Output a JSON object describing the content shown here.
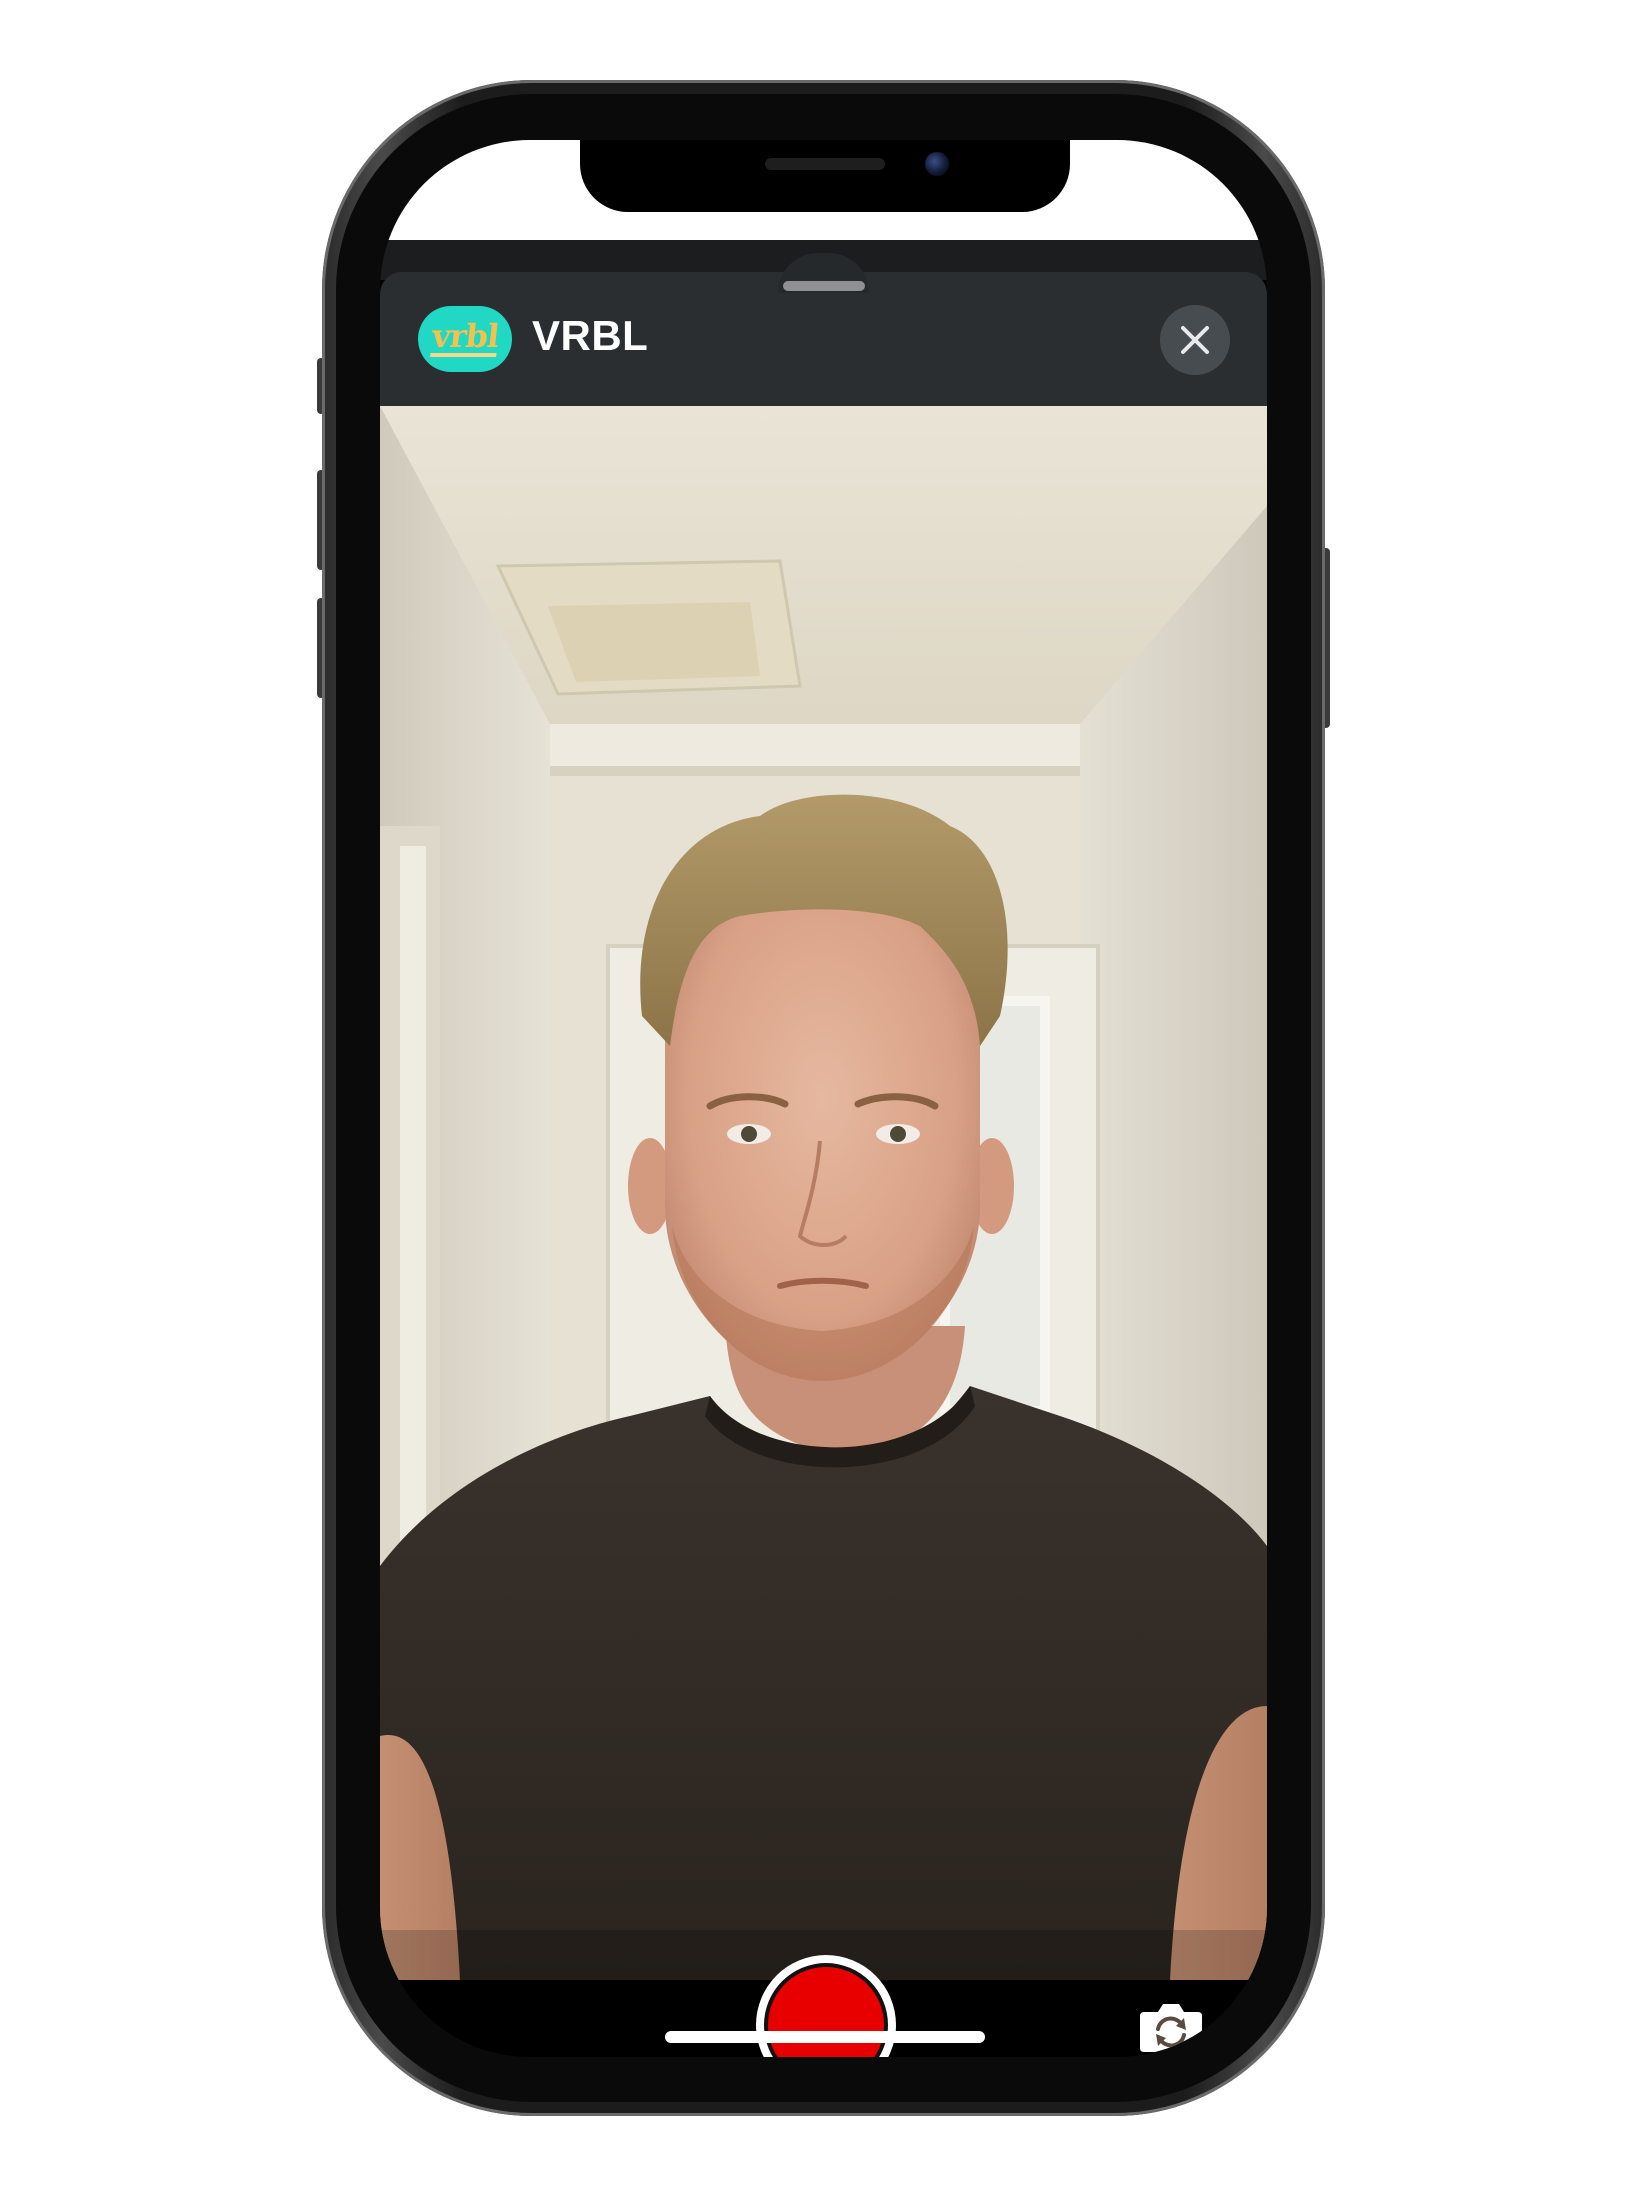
{
  "app": {
    "title": "VRBL",
    "logo_text": "vrbl",
    "logo_color": "#20d8c4"
  },
  "header": {
    "close_icon": "close-x-icon"
  },
  "camera": {
    "record_button_color": "#e80000",
    "record_icon": "record-circle-icon",
    "flip_icon": "camera-flip-icon"
  }
}
